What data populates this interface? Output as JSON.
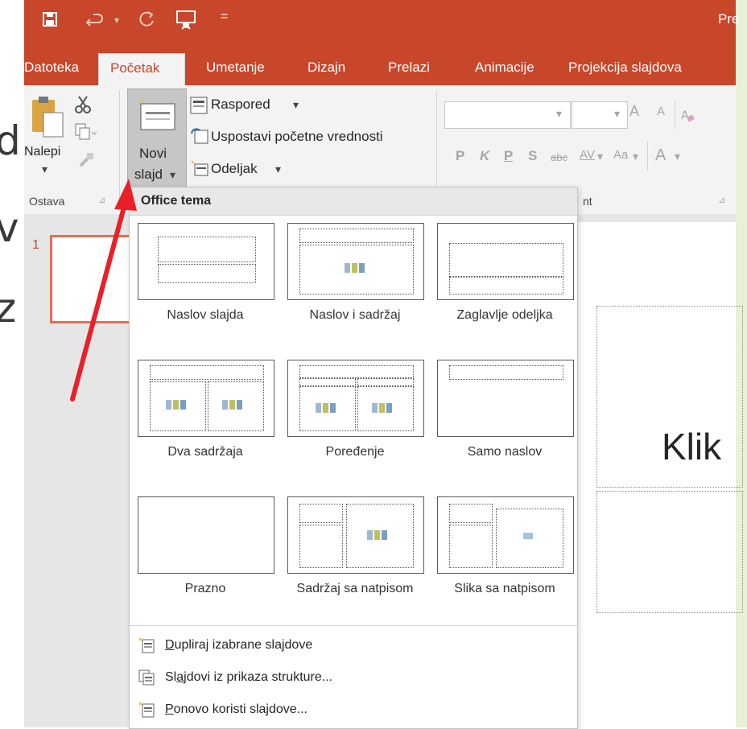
{
  "titlebar": {
    "app_title": "Pre",
    "qat_more": "="
  },
  "background_letters": [
    "d",
    "v",
    "z"
  ],
  "tabs": {
    "file": "Datoteka",
    "home": "Početak",
    "insert": "Umetanje",
    "design": "Dizajn",
    "transitions": "Prelazi",
    "animations": "Animacije",
    "slideshow": "Projekcija slajdova"
  },
  "ribbon": {
    "paste_label": "Nalepi",
    "clipboard_group": "Ostava",
    "new_slide_line1": "Novi",
    "new_slide_line2": "slajd",
    "layout_label": "Raspored",
    "reset_label": "Uspostavi početne vrednosti",
    "section_label": "Odeljak",
    "font_group_partial": "nt",
    "bold": "P",
    "italic": "K",
    "underline": "P",
    "shadow": "S",
    "strike": "abc",
    "spacing": "AV",
    "case": "Aa",
    "grow": "A",
    "shrink": "A",
    "color_a": "A"
  },
  "thumbnails": {
    "slide_number": "1"
  },
  "canvas": {
    "title_partial": "Klik"
  },
  "dropdown": {
    "header": "Office tema",
    "layouts": [
      {
        "label": "Naslov slajda"
      },
      {
        "label": "Naslov i sadržaj"
      },
      {
        "label": "Zaglavlje odeljka"
      },
      {
        "label": "Dva sadržaja"
      },
      {
        "label": "Poređenje"
      },
      {
        "label": "Samo naslov"
      },
      {
        "label": "Prazno"
      },
      {
        "label": "Sadržaj sa natpisom"
      },
      {
        "label": "Slika sa natpisom"
      }
    ],
    "menu": {
      "duplicate_u": "D",
      "duplicate_rest": "upliraj izabrane slajdove",
      "outline_pre": "Sl",
      "outline_u": "a",
      "outline_rest": "jdovi iz prikaza strukture...",
      "reuse_u": "P",
      "reuse_rest": "onovo koristi slajdove..."
    }
  },
  "colors": {
    "accent": "#c8462a",
    "arrow": "#e8202a"
  }
}
